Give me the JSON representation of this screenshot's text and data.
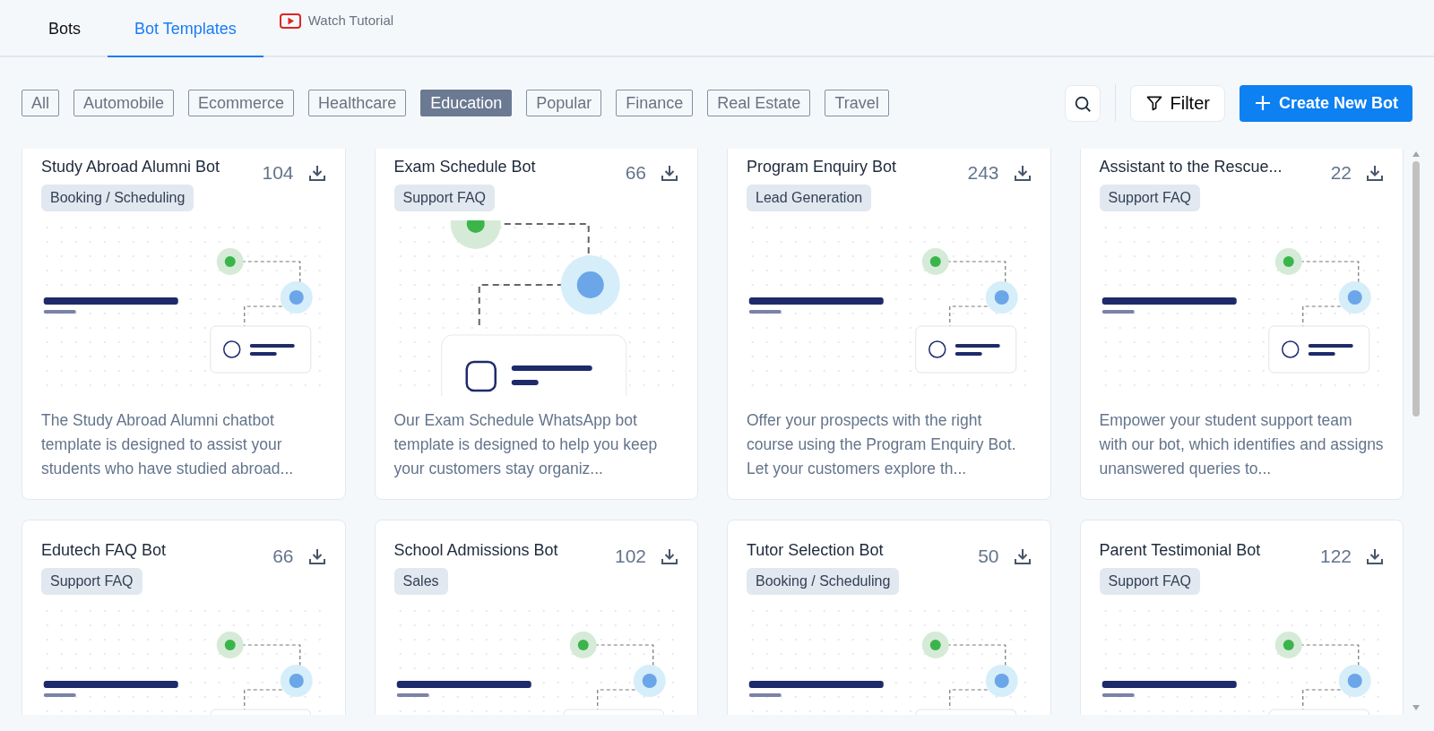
{
  "tabs": [
    {
      "label": "Bots",
      "selected": false
    },
    {
      "label": "Bot Templates",
      "selected": true
    }
  ],
  "tutorial_link": {
    "label": "Watch Tutorial"
  },
  "categories": [
    {
      "label": "All",
      "selected": false
    },
    {
      "label": "Automobile",
      "selected": false
    },
    {
      "label": "Ecommerce",
      "selected": false
    },
    {
      "label": "Healthcare",
      "selected": false
    },
    {
      "label": "Education",
      "selected": true
    },
    {
      "label": "Popular",
      "selected": false
    },
    {
      "label": "Finance",
      "selected": false
    },
    {
      "label": "Real Estate",
      "selected": false
    },
    {
      "label": "Travel",
      "selected": false
    }
  ],
  "filter_button": {
    "label": "Filter"
  },
  "create_button": {
    "label": "Create New Bot"
  },
  "templates": [
    {
      "title": "Study Abroad Alumni Bot",
      "count": "104",
      "tag": "Booking / Scheduling",
      "description": "The Study Abroad Alumni chatbot template is designed to assist your students who have studied abroad..."
    },
    {
      "title": "Exam Schedule Bot",
      "count": "66",
      "tag": "Support FAQ",
      "description": "Our Exam Schedule WhatsApp bot template is designed to help you keep your customers stay organiz..."
    },
    {
      "title": "Program Enquiry Bot",
      "count": "243",
      "tag": "Lead Generation",
      "description": "Offer your prospects with the right course using the Program Enquiry Bot. Let your customers explore th..."
    },
    {
      "title": "Assistant to the Rescue...",
      "count": "22",
      "tag": "Support FAQ",
      "description": "Empower your student support team with our bot, which identifies and assigns unanswered queries to..."
    },
    {
      "title": "Edutech FAQ Bot",
      "count": "66",
      "tag": "Support FAQ"
    },
    {
      "title": "School Admissions Bot",
      "count": "102",
      "tag": "Sales"
    },
    {
      "title": "Tutor Selection Bot",
      "count": "50",
      "tag": "Booking / Scheduling"
    },
    {
      "title": "Parent Testimonial Bot",
      "count": "122",
      "tag": "Support FAQ"
    }
  ]
}
